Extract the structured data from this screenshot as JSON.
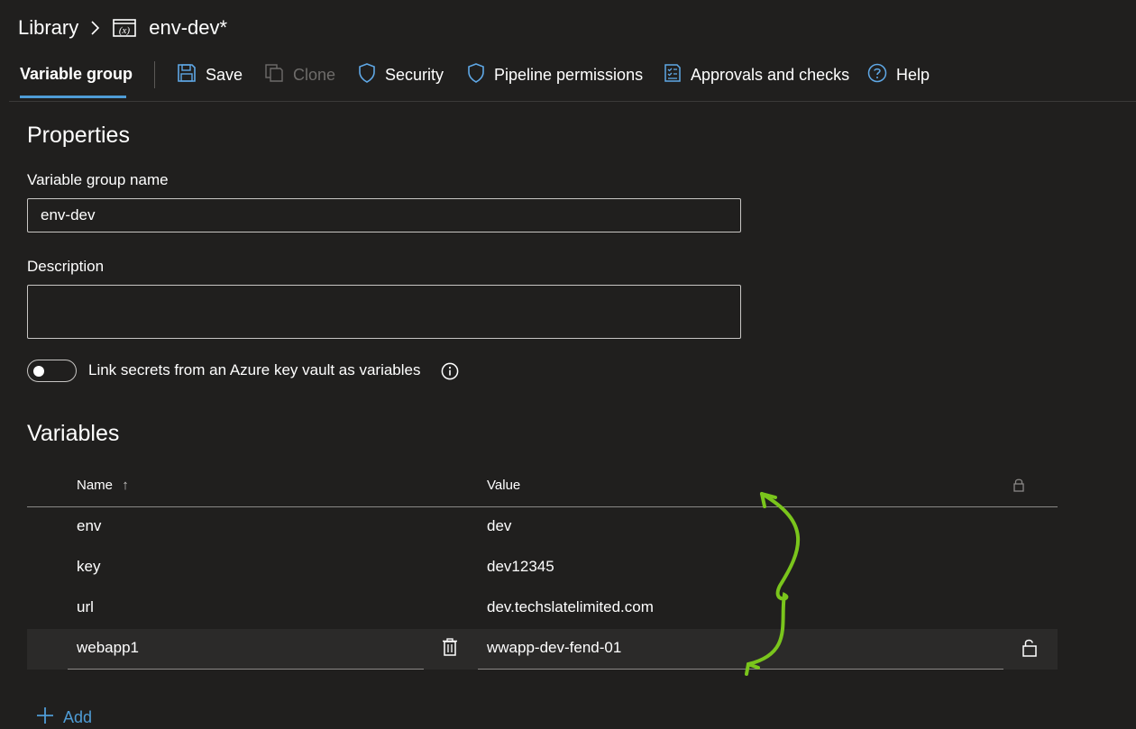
{
  "breadcrumb": {
    "root": "Library",
    "title": "env-dev*"
  },
  "toolbar": {
    "tab_label": "Variable group",
    "save": "Save",
    "clone": "Clone",
    "security": "Security",
    "pipeline_permissions": "Pipeline permissions",
    "approvals": "Approvals and checks",
    "help": "Help"
  },
  "properties": {
    "heading": "Properties",
    "name_label": "Variable group name",
    "name_value": "env-dev",
    "description_label": "Description",
    "description_value": "",
    "keyvault_toggle_label": "Link secrets from an Azure key vault as variables",
    "keyvault_toggle_on": false
  },
  "variables": {
    "heading": "Variables",
    "columns": {
      "name": "Name",
      "value": "Value",
      "sort_indicator": "↑"
    },
    "rows": [
      {
        "name": "env",
        "value": "dev"
      },
      {
        "name": "key",
        "value": "dev12345"
      },
      {
        "name": "url",
        "value": "dev.techslatelimited.com"
      },
      {
        "name": "webapp1",
        "value": "wwapp-dev-fend-01"
      }
    ],
    "add_label": "Add"
  },
  "colors": {
    "accent": "#4f9cd6",
    "background": "#201f1e",
    "annotation": "#7ac51c"
  }
}
